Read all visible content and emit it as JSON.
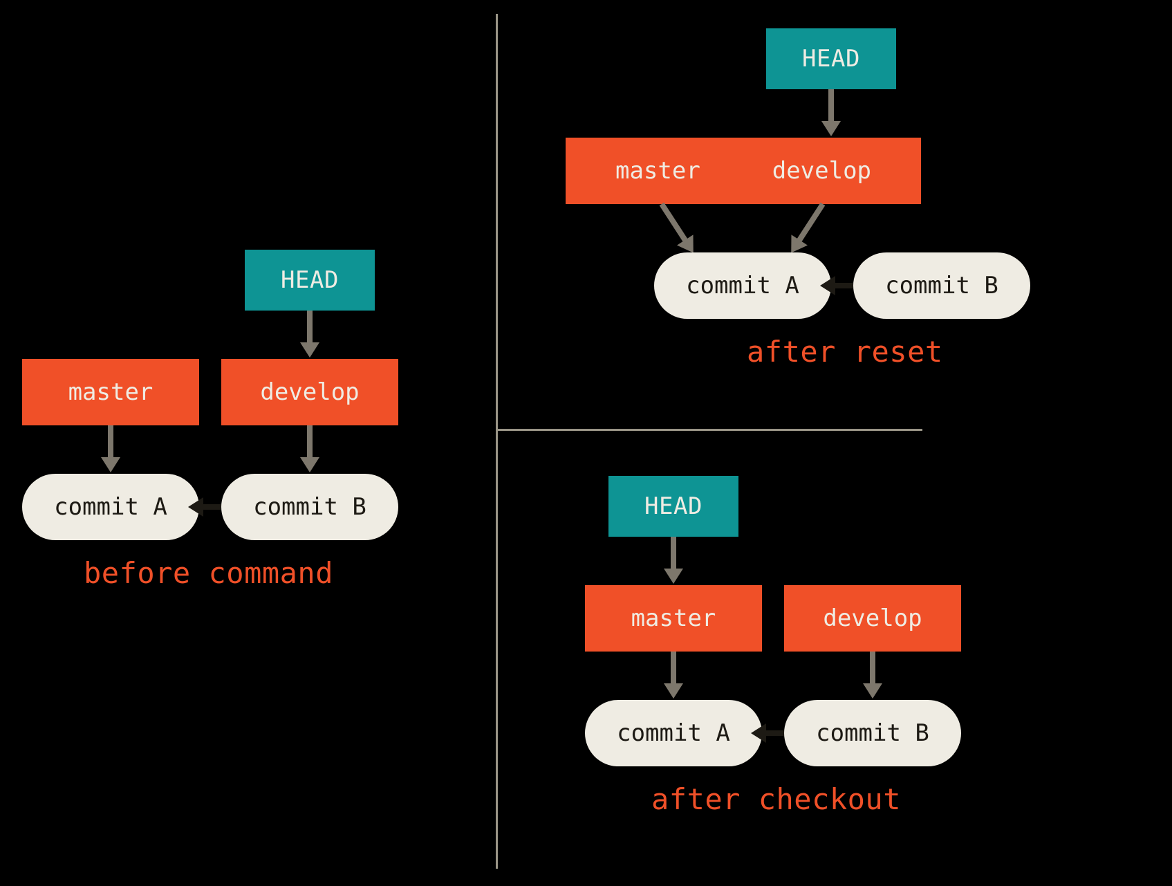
{
  "colors": {
    "background": "#000000",
    "head_fill": "#0e9494",
    "branch_fill": "#f05028",
    "commit_fill": "#efece3",
    "caption": "#f05028",
    "arrow": "#7d776c",
    "commit_arrow": "#1d1a14",
    "divider": "#9a9587"
  },
  "left": {
    "caption": "before command",
    "head": "HEAD",
    "branches": {
      "master": "master",
      "develop": "develop"
    },
    "commits": {
      "a": "commit A",
      "b": "commit B"
    }
  },
  "top_right": {
    "caption": "after reset",
    "head": "HEAD",
    "branches": {
      "master": "master",
      "develop": "develop"
    },
    "commits": {
      "a": "commit A",
      "b": "commit B"
    }
  },
  "bottom_right": {
    "caption": "after checkout",
    "head": "HEAD",
    "branches": {
      "master": "master",
      "develop": "develop"
    },
    "commits": {
      "a": "commit A",
      "b": "commit B"
    }
  }
}
